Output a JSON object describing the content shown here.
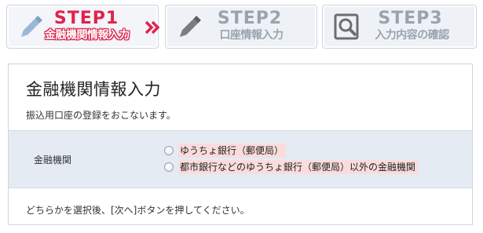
{
  "steps": [
    {
      "number": "STEP1",
      "label": "金融機関情報入力",
      "icon": "pencil-icon",
      "active": true
    },
    {
      "number": "STEP2",
      "label": "口座情報入力",
      "icon": "pencil-icon",
      "active": false
    },
    {
      "number": "STEP3",
      "label": "入力内容の確認",
      "icon": "magnifier-icon",
      "active": false
    }
  ],
  "colors": {
    "active": "#e0234b",
    "inactive": "#9aa3ad",
    "highlight": "#fbdcdc",
    "band": "#e4ebf3"
  },
  "main": {
    "title": "金融機関情報入力",
    "description": "振込用口座の登録をおこないます。",
    "field_label": "金融機関",
    "options": [
      {
        "label": "ゆうちょ銀行（郵便局）",
        "selected": false
      },
      {
        "label": "都市銀行などのゆうちょ銀行（郵便局）以外の金融機関",
        "selected": false
      }
    ],
    "instruction": "どちらかを選択後、[次へ]ボタンを押してください。"
  }
}
